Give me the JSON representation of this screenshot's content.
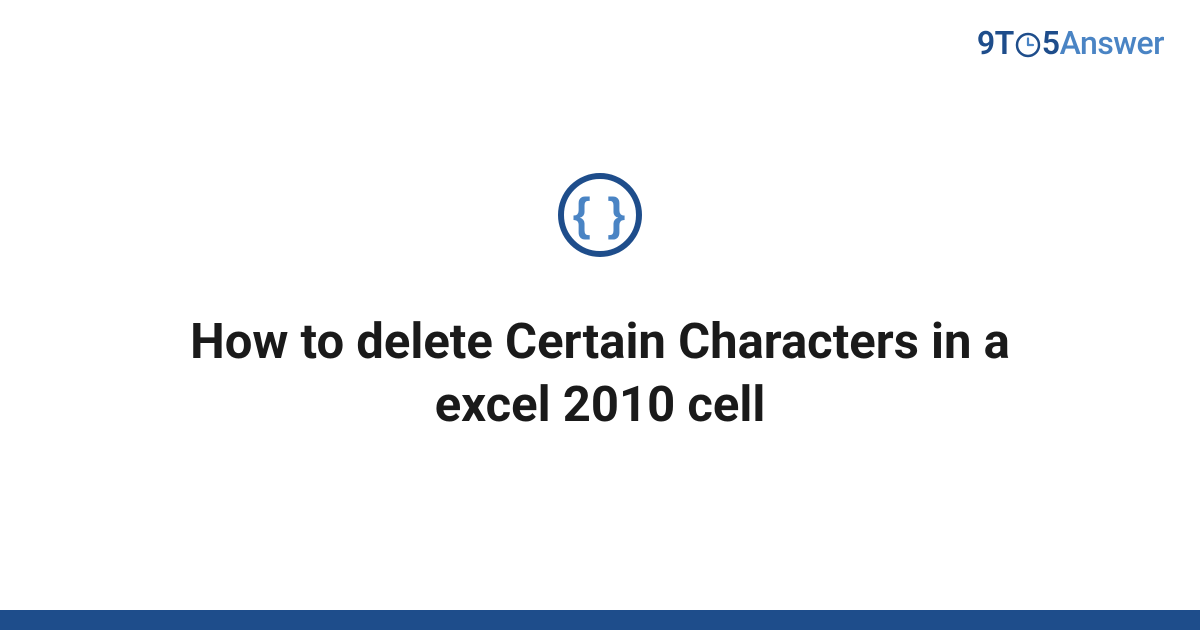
{
  "logo": {
    "part1": "9T",
    "part2": "5",
    "part3": "Answer"
  },
  "category_icon": {
    "name": "code-braces-icon",
    "glyph": "{ }"
  },
  "title": "How to delete Certain Characters in a excel 2010 cell",
  "colors": {
    "brand_dark": "#1e4d8b",
    "brand_light": "#4a84c4"
  }
}
